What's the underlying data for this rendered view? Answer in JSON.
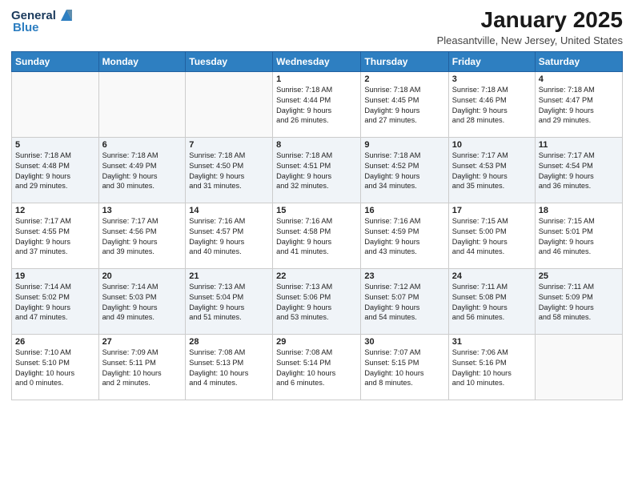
{
  "logo": {
    "general": "General",
    "blue": "Blue"
  },
  "header": {
    "month": "January 2025",
    "location": "Pleasantville, New Jersey, United States"
  },
  "weekdays": [
    "Sunday",
    "Monday",
    "Tuesday",
    "Wednesday",
    "Thursday",
    "Friday",
    "Saturday"
  ],
  "weeks": [
    [
      {
        "day": "",
        "info": ""
      },
      {
        "day": "",
        "info": ""
      },
      {
        "day": "",
        "info": ""
      },
      {
        "day": "1",
        "info": "Sunrise: 7:18 AM\nSunset: 4:44 PM\nDaylight: 9 hours\nand 26 minutes."
      },
      {
        "day": "2",
        "info": "Sunrise: 7:18 AM\nSunset: 4:45 PM\nDaylight: 9 hours\nand 27 minutes."
      },
      {
        "day": "3",
        "info": "Sunrise: 7:18 AM\nSunset: 4:46 PM\nDaylight: 9 hours\nand 28 minutes."
      },
      {
        "day": "4",
        "info": "Sunrise: 7:18 AM\nSunset: 4:47 PM\nDaylight: 9 hours\nand 29 minutes."
      }
    ],
    [
      {
        "day": "5",
        "info": "Sunrise: 7:18 AM\nSunset: 4:48 PM\nDaylight: 9 hours\nand 29 minutes."
      },
      {
        "day": "6",
        "info": "Sunrise: 7:18 AM\nSunset: 4:49 PM\nDaylight: 9 hours\nand 30 minutes."
      },
      {
        "day": "7",
        "info": "Sunrise: 7:18 AM\nSunset: 4:50 PM\nDaylight: 9 hours\nand 31 minutes."
      },
      {
        "day": "8",
        "info": "Sunrise: 7:18 AM\nSunset: 4:51 PM\nDaylight: 9 hours\nand 32 minutes."
      },
      {
        "day": "9",
        "info": "Sunrise: 7:18 AM\nSunset: 4:52 PM\nDaylight: 9 hours\nand 34 minutes."
      },
      {
        "day": "10",
        "info": "Sunrise: 7:17 AM\nSunset: 4:53 PM\nDaylight: 9 hours\nand 35 minutes."
      },
      {
        "day": "11",
        "info": "Sunrise: 7:17 AM\nSunset: 4:54 PM\nDaylight: 9 hours\nand 36 minutes."
      }
    ],
    [
      {
        "day": "12",
        "info": "Sunrise: 7:17 AM\nSunset: 4:55 PM\nDaylight: 9 hours\nand 37 minutes."
      },
      {
        "day": "13",
        "info": "Sunrise: 7:17 AM\nSunset: 4:56 PM\nDaylight: 9 hours\nand 39 minutes."
      },
      {
        "day": "14",
        "info": "Sunrise: 7:16 AM\nSunset: 4:57 PM\nDaylight: 9 hours\nand 40 minutes."
      },
      {
        "day": "15",
        "info": "Sunrise: 7:16 AM\nSunset: 4:58 PM\nDaylight: 9 hours\nand 41 minutes."
      },
      {
        "day": "16",
        "info": "Sunrise: 7:16 AM\nSunset: 4:59 PM\nDaylight: 9 hours\nand 43 minutes."
      },
      {
        "day": "17",
        "info": "Sunrise: 7:15 AM\nSunset: 5:00 PM\nDaylight: 9 hours\nand 44 minutes."
      },
      {
        "day": "18",
        "info": "Sunrise: 7:15 AM\nSunset: 5:01 PM\nDaylight: 9 hours\nand 46 minutes."
      }
    ],
    [
      {
        "day": "19",
        "info": "Sunrise: 7:14 AM\nSunset: 5:02 PM\nDaylight: 9 hours\nand 47 minutes."
      },
      {
        "day": "20",
        "info": "Sunrise: 7:14 AM\nSunset: 5:03 PM\nDaylight: 9 hours\nand 49 minutes."
      },
      {
        "day": "21",
        "info": "Sunrise: 7:13 AM\nSunset: 5:04 PM\nDaylight: 9 hours\nand 51 minutes."
      },
      {
        "day": "22",
        "info": "Sunrise: 7:13 AM\nSunset: 5:06 PM\nDaylight: 9 hours\nand 53 minutes."
      },
      {
        "day": "23",
        "info": "Sunrise: 7:12 AM\nSunset: 5:07 PM\nDaylight: 9 hours\nand 54 minutes."
      },
      {
        "day": "24",
        "info": "Sunrise: 7:11 AM\nSunset: 5:08 PM\nDaylight: 9 hours\nand 56 minutes."
      },
      {
        "day": "25",
        "info": "Sunrise: 7:11 AM\nSunset: 5:09 PM\nDaylight: 9 hours\nand 58 minutes."
      }
    ],
    [
      {
        "day": "26",
        "info": "Sunrise: 7:10 AM\nSunset: 5:10 PM\nDaylight: 10 hours\nand 0 minutes."
      },
      {
        "day": "27",
        "info": "Sunrise: 7:09 AM\nSunset: 5:11 PM\nDaylight: 10 hours\nand 2 minutes."
      },
      {
        "day": "28",
        "info": "Sunrise: 7:08 AM\nSunset: 5:13 PM\nDaylight: 10 hours\nand 4 minutes."
      },
      {
        "day": "29",
        "info": "Sunrise: 7:08 AM\nSunset: 5:14 PM\nDaylight: 10 hours\nand 6 minutes."
      },
      {
        "day": "30",
        "info": "Sunrise: 7:07 AM\nSunset: 5:15 PM\nDaylight: 10 hours\nand 8 minutes."
      },
      {
        "day": "31",
        "info": "Sunrise: 7:06 AM\nSunset: 5:16 PM\nDaylight: 10 hours\nand 10 minutes."
      },
      {
        "day": "",
        "info": ""
      }
    ]
  ]
}
